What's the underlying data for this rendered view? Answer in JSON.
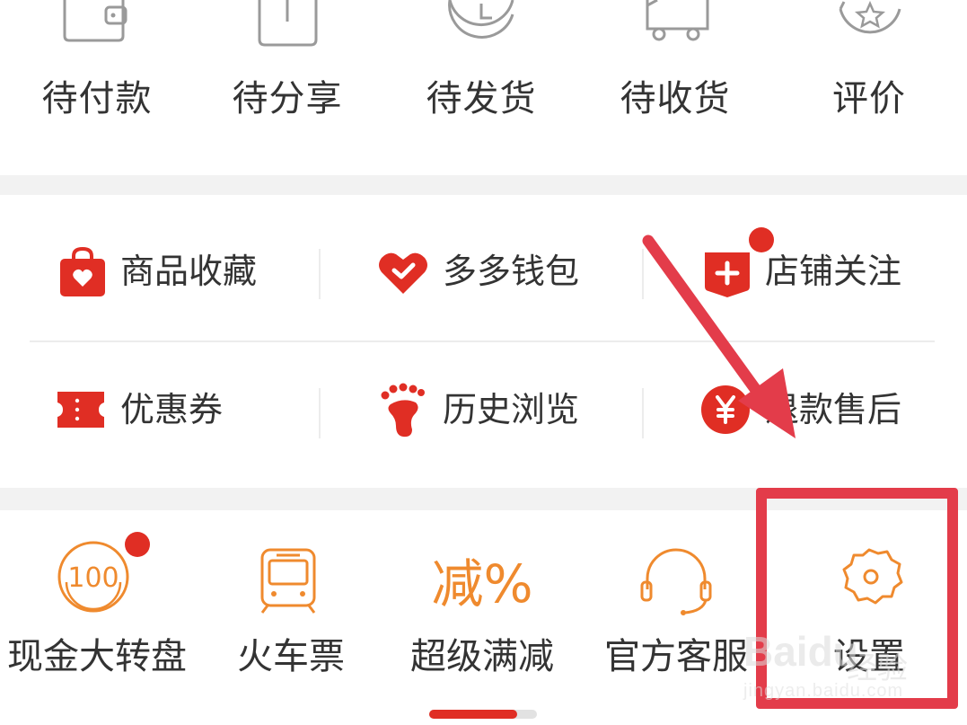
{
  "order_status": {
    "items": [
      {
        "label": "待付款",
        "icon": "wallet-icon"
      },
      {
        "label": "待分享",
        "icon": "share-box-icon"
      },
      {
        "label": "待发货",
        "icon": "clock-icon"
      },
      {
        "label": "待收货",
        "icon": "truck-icon"
      },
      {
        "label": "评价",
        "icon": "star-review-icon"
      }
    ]
  },
  "services": {
    "items": [
      {
        "label": "商品收藏",
        "icon": "shopping-bag-heart-icon"
      },
      {
        "label": "多多钱包",
        "icon": "wallet-heart-check-icon"
      },
      {
        "label": "店铺关注",
        "icon": "store-plus-icon",
        "badge_dot": true
      },
      {
        "label": "优惠券",
        "icon": "coupon-ticket-icon"
      },
      {
        "label": "历史浏览",
        "icon": "footprint-icon"
      },
      {
        "label": "退款售后",
        "icon": "yen-refund-icon"
      }
    ]
  },
  "tools": {
    "items": [
      {
        "label": "现金大转盘",
        "icon": "cash-wheel-100-icon",
        "badge_dot": true
      },
      {
        "label": "火车票",
        "icon": "train-icon"
      },
      {
        "label": "超级满减",
        "icon": "discount-icon",
        "icon_text": "减%"
      },
      {
        "label": "官方客服",
        "icon": "headset-icon"
      },
      {
        "label": "设置",
        "icon": "gear-icon"
      }
    ]
  },
  "watermark": {
    "brand": "Baidu",
    "brand_cn": "经验",
    "url": "jingyan.baidu.com"
  },
  "colors": {
    "accent_red": "#e02e24",
    "tool_orange": "#ef8a2e",
    "annotation_red": "#e33c4a",
    "outline_gray": "#9a9a9a",
    "separator_gray": "#f2f2f2"
  }
}
